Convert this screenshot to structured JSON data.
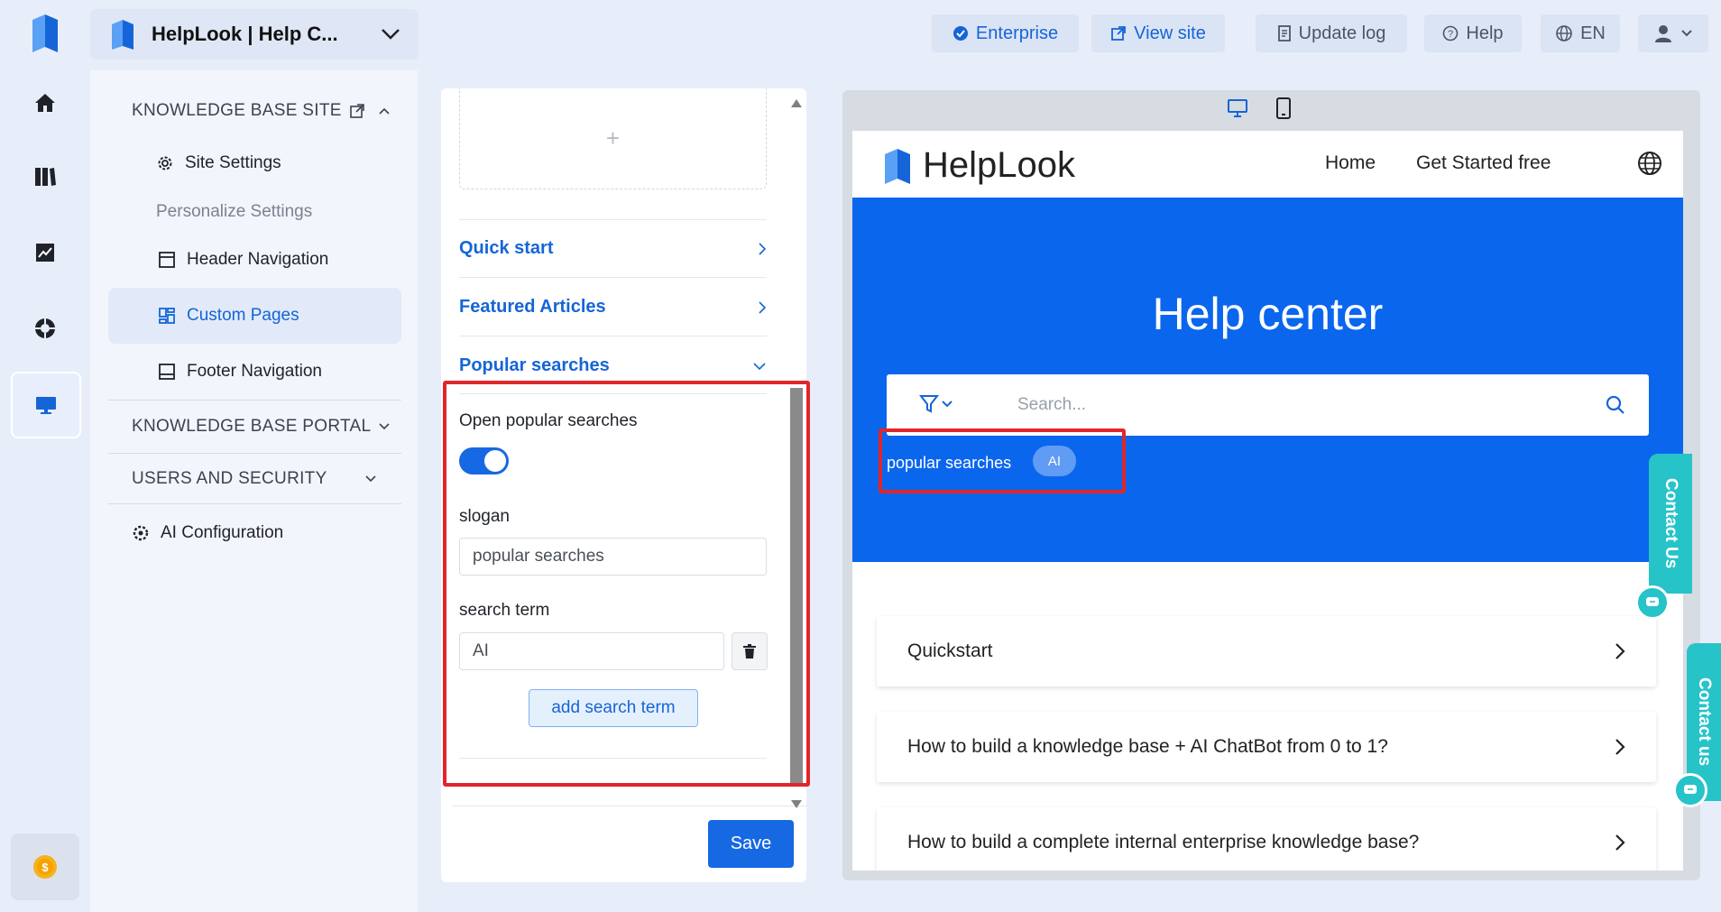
{
  "topbar": {
    "space_name": "HelpLook | Help C...",
    "buttons": {
      "enterprise": "Enterprise",
      "view_site": "View site",
      "update_log": "Update log",
      "help": "Help",
      "language": "EN"
    }
  },
  "sidenav": {
    "kb_site": "KNOWLEDGE BASE SITE",
    "site_settings": "Site Settings",
    "personalize": "Personalize Settings",
    "header_nav": "Header Navigation",
    "custom_pages": "Custom Pages",
    "footer_nav": "Footer Navigation",
    "kb_portal": "KNOWLEDGE BASE PORTAL",
    "users_security": "USERS AND SECURITY",
    "ai_config": "AI Configuration"
  },
  "editor": {
    "upload_plus": "+",
    "sections": {
      "quick_start": "Quick start",
      "featured": "Featured Articles",
      "popular": "Popular searches"
    },
    "open_popular_label": "Open popular searches",
    "open_popular_enabled": true,
    "slogan_label": "slogan",
    "slogan_value": "popular searches",
    "search_term_label": "search term",
    "search_term_value": "AI",
    "add_term_button": "add search term",
    "save_button": "Save"
  },
  "preview": {
    "brand": "HelpLook",
    "nav_home": "Home",
    "nav_get_started": "Get Started free",
    "hero_title": "Help center",
    "search_placeholder": "Search...",
    "popular_label": "popular searches",
    "popular_chip": "AI",
    "contact_label": "Contact Us",
    "contact_label_2": "Contact us",
    "articles": [
      "Quickstart",
      "How to build a knowledge base + AI ChatBot from 0 to 1?",
      "How to build a complete internal enterprise knowledge base?"
    ]
  },
  "colors": {
    "primary": "#1668e3",
    "hero": "#0b66ee",
    "highlight": "#e0262a",
    "contact": "#26c3c9"
  }
}
